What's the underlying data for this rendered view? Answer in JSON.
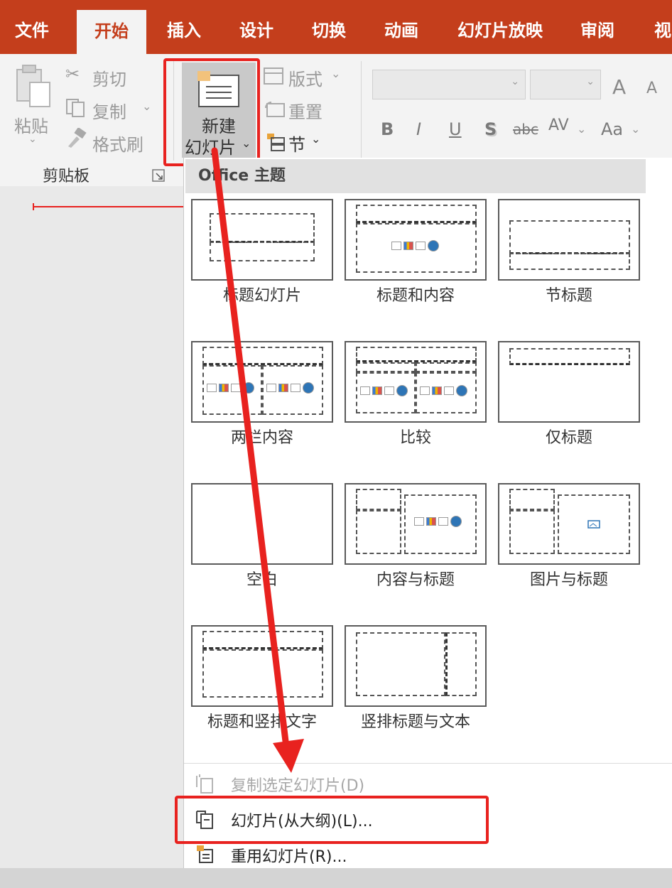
{
  "tabs": [
    {
      "label": "文件",
      "active": false
    },
    {
      "label": "开始",
      "active": true
    },
    {
      "label": "插入",
      "active": false
    },
    {
      "label": "设计",
      "active": false
    },
    {
      "label": "切换",
      "active": false
    },
    {
      "label": "动画",
      "active": false
    },
    {
      "label": "幻灯片放映",
      "active": false
    },
    {
      "label": "审阅",
      "active": false
    },
    {
      "label": "视图",
      "active": false
    }
  ],
  "clipboard": {
    "paste": "粘贴",
    "cut": "剪切",
    "copy": "复制",
    "format_painter": "格式刷",
    "group_label": "剪贴板"
  },
  "slides": {
    "new_slide_line1": "新建",
    "new_slide_line2": "幻灯片",
    "layout": "版式",
    "reset": "重置",
    "section": "节"
  },
  "font": {
    "bold": "B",
    "italic": "I",
    "underline": "U",
    "shadow": "S",
    "strikethrough": "abc",
    "spacing": "AV",
    "case": "Aa",
    "grow": "A",
    "shrink": "A"
  },
  "dropdown": {
    "theme_header": "Office 主题",
    "layouts": [
      {
        "name": "标题幻灯片"
      },
      {
        "name": "标题和内容"
      },
      {
        "name": "节标题"
      },
      {
        "name": "两栏内容"
      },
      {
        "name": "比较"
      },
      {
        "name": "仅标题"
      },
      {
        "name": "空白"
      },
      {
        "name": "内容与标题"
      },
      {
        "name": "图片与标题"
      },
      {
        "name": "标题和竖排文字"
      },
      {
        "name": "竖排标题与文本"
      }
    ],
    "menu": [
      {
        "label": "复制选定幻灯片(D)",
        "disabled": true
      },
      {
        "label": "幻灯片(从大纲)(L)...",
        "disabled": false
      },
      {
        "label": "重用幻灯片(R)...",
        "disabled": false
      }
    ]
  },
  "colors": {
    "accent": "#c43e1c",
    "highlight": "#e8221f"
  }
}
